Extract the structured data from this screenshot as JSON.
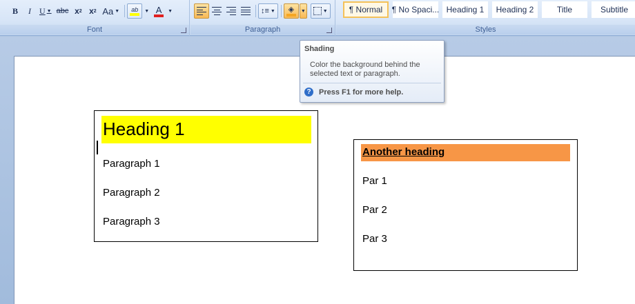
{
  "ribbon": {
    "font_group": {
      "label": "Font",
      "bold": "B",
      "italic": "I",
      "underline": "U",
      "strikethrough": "abc",
      "subscript_base": "x",
      "subscript_mark": "2",
      "superscript_base": "x",
      "superscript_mark": "2",
      "change_case": "Aa",
      "highlight_glyph": "ab",
      "font_color_glyph": "A",
      "highlight_color": "#ffff00",
      "font_color": "#e02020"
    },
    "paragraph_group": {
      "label": "Paragraph",
      "shading_color": "#f5a623"
    },
    "styles_group": {
      "label": "Styles",
      "items": [
        "¶ Normal",
        "¶ No Spaci...",
        "Heading 1",
        "Heading 2",
        "Title",
        "Subtitle"
      ]
    }
  },
  "tooltip": {
    "title": "Shading",
    "body": "Color the background behind the selected text or paragraph.",
    "help": "Press F1 for more help."
  },
  "document": {
    "box1": {
      "heading": "Heading 1",
      "heading_shading": "#ffff00",
      "paragraphs": [
        "Paragraph 1",
        "Paragraph 2",
        "Paragraph 3"
      ]
    },
    "box2": {
      "heading": "Another heading",
      "heading_shading": "#f79646",
      "paragraphs": [
        "Par 1",
        "Par 2",
        "Par 3"
      ]
    }
  }
}
